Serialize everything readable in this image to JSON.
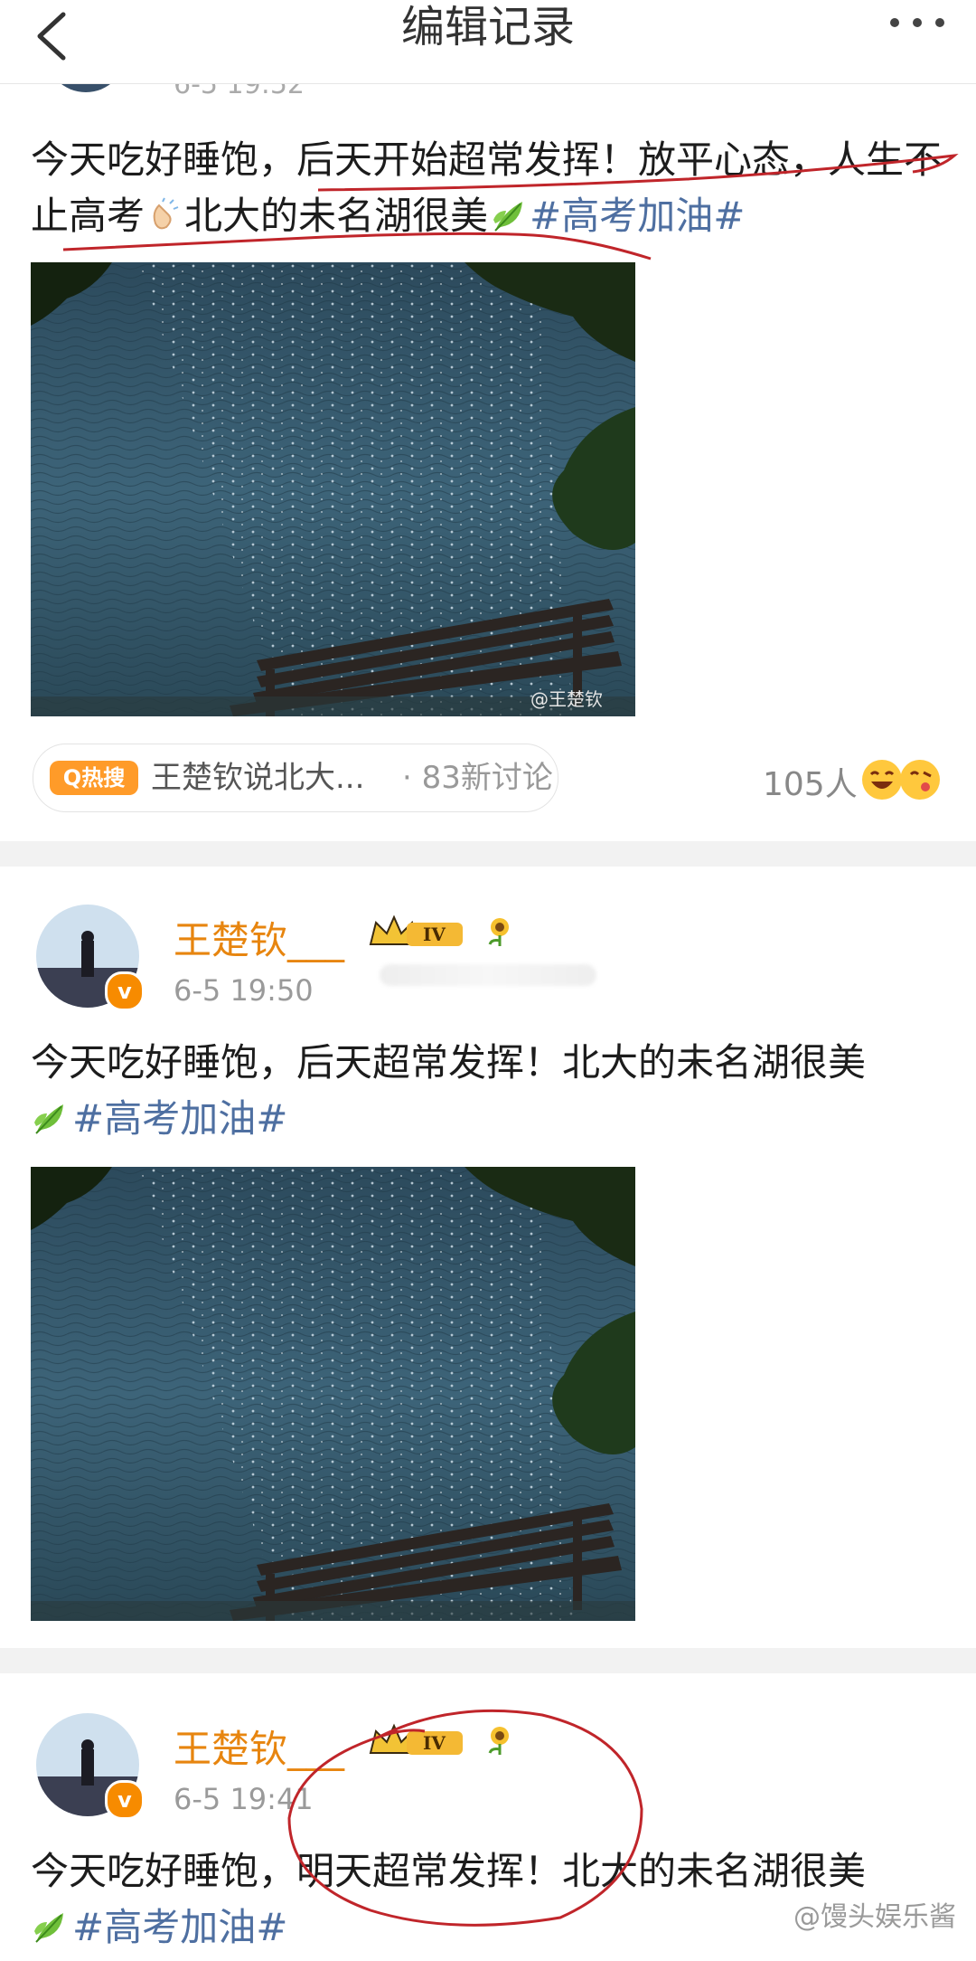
{
  "header": {
    "title": "编辑记录"
  },
  "post1": {
    "time": "6-5 19:52",
    "text_parts": [
      "今天吃好睡饱，后天开始超常发挥！放平心态，人生不止高考",
      "北大的未名湖很美",
      "#高考加油#"
    ],
    "image_watermark": "@王楚钦",
    "hot_badge": "Q热搜",
    "hot_text": "王楚钦说北大...",
    "hot_count": "· 83新讨论",
    "reactions": "105人"
  },
  "post2": {
    "username": "王楚钦___",
    "level": "IV",
    "time": "6-5 19:50",
    "text_main": "今天吃好睡饱，后天超常发挥！北大的未名湖很美",
    "topic": "#高考加油#"
  },
  "post3": {
    "username": "王楚钦___",
    "level": "IV",
    "time": "6-5 19:41",
    "text_main": "今天吃好睡饱，明天超常发挥！北大的未名湖很美",
    "topic": "#高考加油#"
  },
  "footer": {
    "watermark": "@馒头娱乐酱"
  },
  "icons": [
    "back-icon",
    "more-icon",
    "verified-icon",
    "crown-badge-icon",
    "sunflower-icon",
    "leaf-emoji-icon",
    "clap-emoji-icon",
    "search-hot-icon",
    "laugh-emoji-icon"
  ],
  "colors": {
    "username": "#e7850f",
    "topic": "#4e6fa1",
    "annotation": "#c0252a",
    "badge": "#ff9b29"
  }
}
